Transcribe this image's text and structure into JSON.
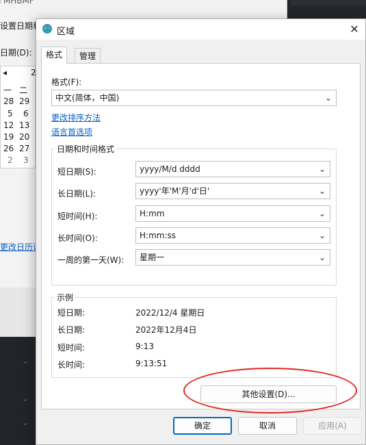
{
  "background_window": {
    "title_partial": "I'MHBMF",
    "set_date_partial": "设置日期和",
    "date_label_partial": "日期(D):",
    "cal_nav_prev": "◂",
    "cal_month_partial": "2",
    "cal_header": [
      "一",
      "二"
    ],
    "cal_rows": [
      [
        "28",
        "29"
      ],
      [
        "5",
        "6"
      ],
      [
        "12",
        "13"
      ],
      [
        "19",
        "20"
      ],
      [
        "26",
        "27"
      ],
      [
        "2",
        "3"
      ]
    ],
    "change_calendar_link_partial": "更改日历设"
  },
  "dialog": {
    "title": "区域",
    "close": "✕",
    "tabs": [
      {
        "label": "格式"
      },
      {
        "label": "管理"
      }
    ],
    "format_label": "格式(F):",
    "format_value": "中文(简体，中国)",
    "link_sort": "更改排序方法",
    "link_lang": "语言首选项",
    "datetime_group_title": "日期和时间格式",
    "fields": [
      {
        "label": "短日期(S):",
        "value": "yyyy/M/d dddd"
      },
      {
        "label": "长日期(L):",
        "value": "yyyy'年'M'月'd'日'"
      },
      {
        "label": "短时间(H):",
        "value": "H:mm"
      },
      {
        "label": "长时间(O):",
        "value": "H:mm:ss"
      },
      {
        "label": "一周的第一天(W):",
        "value": "星期一"
      }
    ],
    "example_group_title": "示例",
    "examples": [
      {
        "label": "短日期:",
        "value": "2022/12/4 星期日"
      },
      {
        "label": "长日期:",
        "value": "2022年12月4日"
      },
      {
        "label": "短时间:",
        "value": "9:13"
      },
      {
        "label": "长时间:",
        "value": "9:13:51"
      }
    ],
    "other_settings": "其他设置(D)...",
    "ok": "确定",
    "cancel": "取消",
    "apply": "应用(A)"
  },
  "colors": {
    "link": "#0a5fc7",
    "annotation": "#e0261f",
    "accent": "#0067c0"
  }
}
